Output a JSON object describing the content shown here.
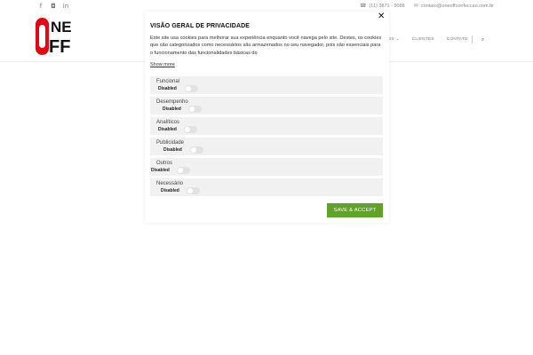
{
  "site": {
    "social": [
      {
        "icon": "facebook-icon",
        "glyph": "f"
      },
      {
        "icon": "instagram-icon",
        "glyph": "◘"
      },
      {
        "icon": "linkedin-icon",
        "glyph": "in"
      }
    ],
    "phone_icon": "phone-icon",
    "phone": "(11) 3871 - 9088",
    "email_icon": "mail-icon",
    "email": "contato@oneoffconfeccao.com.br",
    "logo": {
      "line1": "NE",
      "line2": "FF"
    },
    "nav": {
      "item_partial": "...OS",
      "item_partial_chevron": "⌄",
      "clientes": "CLIENTES",
      "contato": "CONTATO",
      "search_icon": "search-icon"
    }
  },
  "privacy_modal": {
    "title": "VISÃO GERAL DE PRIVACIDADE",
    "close_glyph": "✕",
    "description": "Este site usa cookies para melhorar sua experiência enquanto você navega pelo site. Destes, os cookies que são categorizados como necessários são armazenados no seu navegador, pois são essenciais para o funcionamento das funcionalidades básicas do",
    "show_more": "Show more",
    "categories": [
      {
        "name": "Funcional",
        "status": "Disabled"
      },
      {
        "name": "Desempenho",
        "status": "Disabled"
      },
      {
        "name": "Analíticos",
        "status": "Disabled"
      },
      {
        "name": "Publicidade",
        "status": "Disabled"
      },
      {
        "name": "Outros",
        "status": "Disabled"
      },
      {
        "name": "Necessário",
        "status": "Disabled"
      }
    ],
    "save_label": "SAVE & ACCEPT",
    "accent_color": "#61a229"
  }
}
